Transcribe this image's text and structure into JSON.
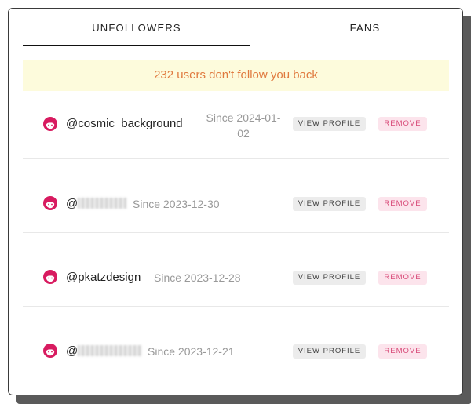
{
  "tabs": [
    {
      "label": "UNFOLLOWERS",
      "active": true
    },
    {
      "label": "FANS",
      "active": false
    }
  ],
  "banner": {
    "text": "232 users don't follow you back"
  },
  "rows": [
    {
      "handle": "@cosmic_background",
      "since": "Since 2024-01-02"
    },
    {
      "handle": "@",
      "handle_redacted": true,
      "since": "Since 2023-12-30"
    },
    {
      "handle": "@pkatzdesign",
      "since": "Since 2023-12-28"
    },
    {
      "handle": "@",
      "handle_redacted": true,
      "since": "Since 2023-12-21"
    }
  ],
  "buttons": {
    "view_label": "VIEW PROFILE",
    "remove_label": "REMOVE"
  },
  "colors": {
    "avatar": "#d81b60",
    "banner_bg": "#fdfbdc",
    "banner_text": "#e07a3f",
    "remove_bg": "#fce4ec",
    "remove_text": "#d84a78",
    "view_bg": "#ececec"
  },
  "icons": {
    "avatar": "face-avatar-icon"
  }
}
